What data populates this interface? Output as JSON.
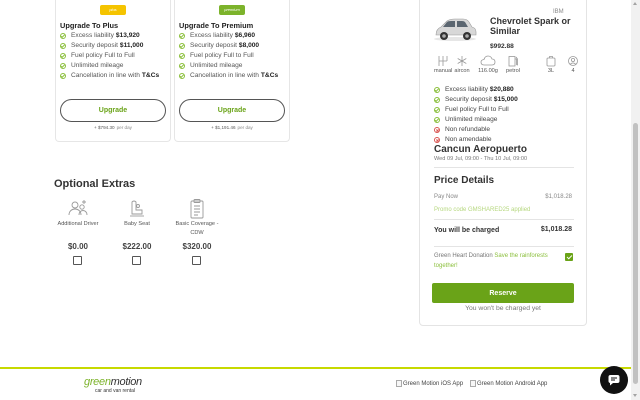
{
  "plans": [
    {
      "id": "plus",
      "badge": "plus",
      "title": "Upgrade To Plus",
      "features": [
        {
          "text": "Excess liability",
          "bold": "$13,920"
        },
        {
          "text": "Security deposit",
          "bold": "$11,000"
        },
        {
          "text": "Fuel policy Full to Full",
          "bold": ""
        },
        {
          "text": "Unlimited mileage",
          "bold": ""
        },
        {
          "text": "Cancellation in line with",
          "bold": "T&Cs"
        }
      ],
      "button_label": "Upgrade",
      "price": "+ $794.30",
      "per": "per day"
    },
    {
      "id": "premium",
      "badge": "premium",
      "title": "Upgrade To Premium",
      "features": [
        {
          "text": "Excess liability",
          "bold": "$6,960"
        },
        {
          "text": "Security deposit",
          "bold": "$8,000"
        },
        {
          "text": "Fuel policy Full to Full",
          "bold": ""
        },
        {
          "text": "Unlimited mileage",
          "bold": ""
        },
        {
          "text": "Cancellation in line with",
          "bold": "T&Cs"
        }
      ],
      "button_label": "Upgrade",
      "price": "+ $1,191.46",
      "per": "per day"
    }
  ],
  "extras": {
    "title": "Optional Extras",
    "items": [
      {
        "label": "Additional Driver",
        "price": "$0.00",
        "icon": "add-driver-icon"
      },
      {
        "label": "Baby Seat",
        "price": "$222.00",
        "icon": "baby-seat-icon"
      },
      {
        "label": "Basic Coverage - CDW",
        "price": "$320.00",
        "icon": "clipboard-icon"
      }
    ]
  },
  "summary": {
    "car_code": "IBM",
    "car_name": "Chevrolet Spark or Similar",
    "car_price": "$992.88",
    "specs": [
      {
        "label": "manual",
        "icon": "gearbox-icon"
      },
      {
        "label": "aircon",
        "icon": "snowflake-icon"
      },
      {
        "label": "116.00g",
        "icon": "co2-cloud-icon"
      },
      {
        "label": "petrol",
        "icon": "fuel-icon"
      },
      {
        "label": "3L",
        "icon": "luggage-icon"
      },
      {
        "label": "4",
        "icon": "seats-icon"
      }
    ],
    "features": [
      {
        "type": "check",
        "text": "Excess liability",
        "bold": "$20,880"
      },
      {
        "type": "check",
        "text": "Security deposit",
        "bold": "$15,000"
      },
      {
        "type": "check",
        "text": "Fuel policy Full to Full",
        "bold": ""
      },
      {
        "type": "check",
        "text": "Unlimited mileage",
        "bold": ""
      },
      {
        "type": "cross",
        "text": "Non refundable",
        "bold": ""
      },
      {
        "type": "cross",
        "text": "Non amendable",
        "bold": ""
      }
    ],
    "location": "Cancun Aeropuerto",
    "dates": "Wed 09 Jul, 09:00 - Thu 10 Jul, 09:00",
    "price_title": "Price Details",
    "pay_now_label": "Pay Now",
    "pay_now_value": "$1,018.28",
    "promo": "Promo code GMSHARED25 applied",
    "charged_label": "You will be charged",
    "charged_value": "$1,018.28",
    "donation_label": "Green Heart Donation",
    "donation_link": "Save the rainforests together!",
    "donation_checked": true,
    "reserve_label": "Reserve",
    "no_charge_text": "You won't be charged yet"
  },
  "footer": {
    "logo_main": "green",
    "logo_accent": "motion",
    "logo_tagline": "car and van rental",
    "ios_label": "Green Motion iOS App",
    "android_label": "Green Motion Android App"
  },
  "colors": {
    "brand_green": "#6aa318",
    "plus_badge": "#f5c400",
    "premium_badge": "#7cb32b",
    "footer_line": "#c7d900"
  }
}
